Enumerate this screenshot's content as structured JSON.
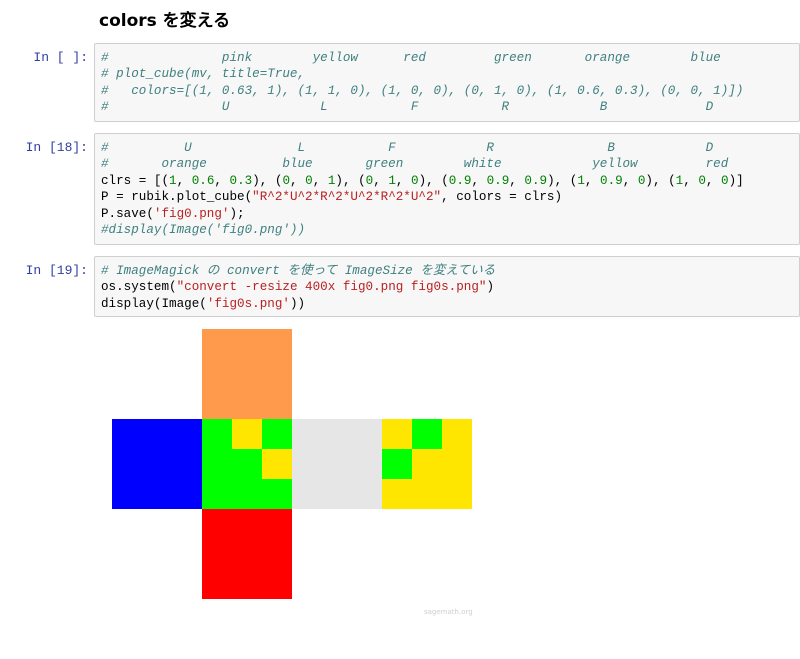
{
  "heading": "colors を変える",
  "cells": [
    {
      "prompt": "In [ ]:",
      "lines": [
        [
          {
            "t": "#               pink        yellow      red         green       orange        blue",
            "c": "cm"
          }
        ],
        [
          {
            "t": "# plot_cube(mv, title=True,",
            "c": "cm"
          }
        ],
        [
          {
            "t": "#   colors=[(1, 0.63, 1), (1, 1, 0), (1, 0, 0), (0, 1, 0), (1, 0.6, 0.3), (0, 0, 1)])",
            "c": "cm"
          }
        ],
        [
          {
            "t": "#               U            L           F           R            B             D",
            "c": "cm"
          }
        ]
      ]
    },
    {
      "prompt": "In [18]:",
      "lines": [
        [
          {
            "t": "#          U              L           F            R               B            D",
            "c": "cm"
          }
        ],
        [
          {
            "t": "#       orange          blue       green        white            yellow         red",
            "c": "cm"
          }
        ],
        [
          {
            "t": "clrs = [(",
            "c": ""
          },
          {
            "t": "1",
            "c": "nu"
          },
          {
            "t": ", ",
            "c": ""
          },
          {
            "t": "0.6",
            "c": "nu"
          },
          {
            "t": ", ",
            "c": ""
          },
          {
            "t": "0.3",
            "c": "nu"
          },
          {
            "t": "), (",
            "c": ""
          },
          {
            "t": "0",
            "c": "nu"
          },
          {
            "t": ", ",
            "c": ""
          },
          {
            "t": "0",
            "c": "nu"
          },
          {
            "t": ", ",
            "c": ""
          },
          {
            "t": "1",
            "c": "nu"
          },
          {
            "t": "), (",
            "c": ""
          },
          {
            "t": "0",
            "c": "nu"
          },
          {
            "t": ", ",
            "c": ""
          },
          {
            "t": "1",
            "c": "nu"
          },
          {
            "t": ", ",
            "c": ""
          },
          {
            "t": "0",
            "c": "nu"
          },
          {
            "t": "), (",
            "c": ""
          },
          {
            "t": "0.9",
            "c": "nu"
          },
          {
            "t": ", ",
            "c": ""
          },
          {
            "t": "0.9",
            "c": "nu"
          },
          {
            "t": ", ",
            "c": ""
          },
          {
            "t": "0.9",
            "c": "nu"
          },
          {
            "t": "), (",
            "c": ""
          },
          {
            "t": "1",
            "c": "nu"
          },
          {
            "t": ", ",
            "c": ""
          },
          {
            "t": "0.9",
            "c": "nu"
          },
          {
            "t": ", ",
            "c": ""
          },
          {
            "t": "0",
            "c": "nu"
          },
          {
            "t": "), (",
            "c": ""
          },
          {
            "t": "1",
            "c": "nu"
          },
          {
            "t": ", ",
            "c": ""
          },
          {
            "t": "0",
            "c": "nu"
          },
          {
            "t": ", ",
            "c": ""
          },
          {
            "t": "0",
            "c": "nu"
          },
          {
            "t": ")]",
            "c": ""
          }
        ],
        [
          {
            "t": "P = rubik.plot_cube(",
            "c": ""
          },
          {
            "t": "\"R^2*U^2*R^2*U^2*R^2*U^2\"",
            "c": "st"
          },
          {
            "t": ", colors = clrs)",
            "c": ""
          }
        ],
        [
          {
            "t": "P.save(",
            "c": ""
          },
          {
            "t": "'fig0.png'",
            "c": "st"
          },
          {
            "t": ");",
            "c": ""
          }
        ],
        [
          {
            "t": "#display(Image('fig0.png'))",
            "c": "cm"
          }
        ]
      ]
    },
    {
      "prompt": "In [19]:",
      "lines": [
        [
          {
            "t": "# ImageMagick の convert を使って ImageSize を変えている",
            "c": "cm"
          }
        ],
        [
          {
            "t": "os.system(",
            "c": ""
          },
          {
            "t": "\"convert -resize 400x fig0.png fig0s.png\"",
            "c": "st"
          },
          {
            "t": ")",
            "c": ""
          }
        ],
        [
          {
            "t": "display(Image(",
            "c": ""
          },
          {
            "t": "'fig0s.png'",
            "c": "st"
          },
          {
            "t": "))",
            "c": ""
          }
        ]
      ]
    }
  ],
  "cube_net": {
    "colors": {
      "orange": "#ff9a4d",
      "blue": "#0000ff",
      "green": "#00ff00",
      "white": "#e6e6e6",
      "yellow": "#ffe600",
      "red": "#ff0000"
    },
    "faces": [
      {
        "name": "U",
        "fill": "orange",
        "col": 1,
        "row": 0,
        "stickers": []
      },
      {
        "name": "L",
        "fill": "blue",
        "col": 0,
        "row": 1,
        "stickers": []
      },
      {
        "name": "F",
        "fill": "green",
        "col": 1,
        "row": 1,
        "stickers": [
          {
            "col": 1,
            "row": 0,
            "color": "yellow"
          },
          {
            "col": 2,
            "row": 1,
            "color": "yellow"
          }
        ]
      },
      {
        "name": "R",
        "fill": "white",
        "col": 2,
        "row": 1,
        "stickers": []
      },
      {
        "name": "B",
        "fill": "yellow",
        "col": 3,
        "row": 1,
        "stickers": [
          {
            "col": 1,
            "row": 0,
            "color": "green"
          },
          {
            "col": 0,
            "row": 1,
            "color": "green"
          }
        ]
      },
      {
        "name": "D",
        "fill": "red",
        "col": 1,
        "row": 2,
        "stickers": []
      }
    ]
  },
  "watermark": "sagemath.org"
}
